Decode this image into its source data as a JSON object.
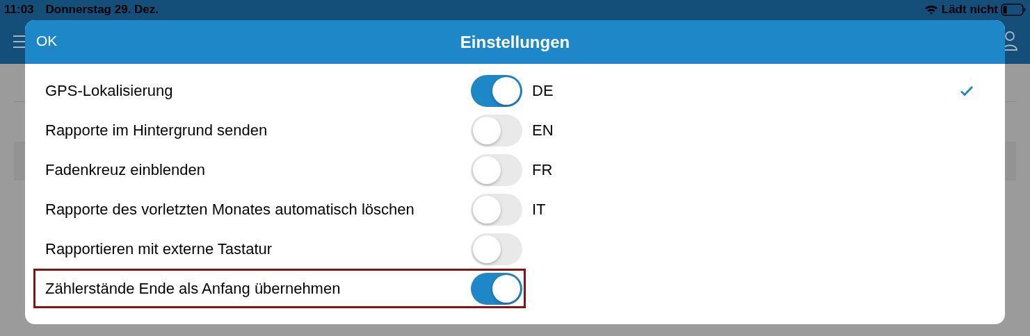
{
  "status_bar": {
    "time": "11:03",
    "date": "Donnerstag 29. Dez.",
    "charging": "Lädt nicht"
  },
  "dialog": {
    "ok_button": "OK",
    "title": "Einstellungen",
    "settings": [
      {
        "label": "GPS-Lokalisierung",
        "on": true,
        "highlighted": false
      },
      {
        "label": "Rapporte im Hintergrund senden",
        "on": false,
        "highlighted": false
      },
      {
        "label": "Fadenkreuz einblenden",
        "on": false,
        "highlighted": false
      },
      {
        "label": "Rapporte des vorletzten Monates automatisch löschen",
        "on": false,
        "highlighted": false
      },
      {
        "label": "Rapportieren mit externe Tastatur",
        "on": false,
        "highlighted": false
      },
      {
        "label": "Zählerstände Ende als Anfang übernehmen",
        "on": true,
        "highlighted": true
      }
    ],
    "languages": [
      {
        "label": "DE",
        "selected": true
      },
      {
        "label": "EN",
        "selected": false
      },
      {
        "label": "FR",
        "selected": false
      },
      {
        "label": "IT",
        "selected": false
      }
    ]
  }
}
